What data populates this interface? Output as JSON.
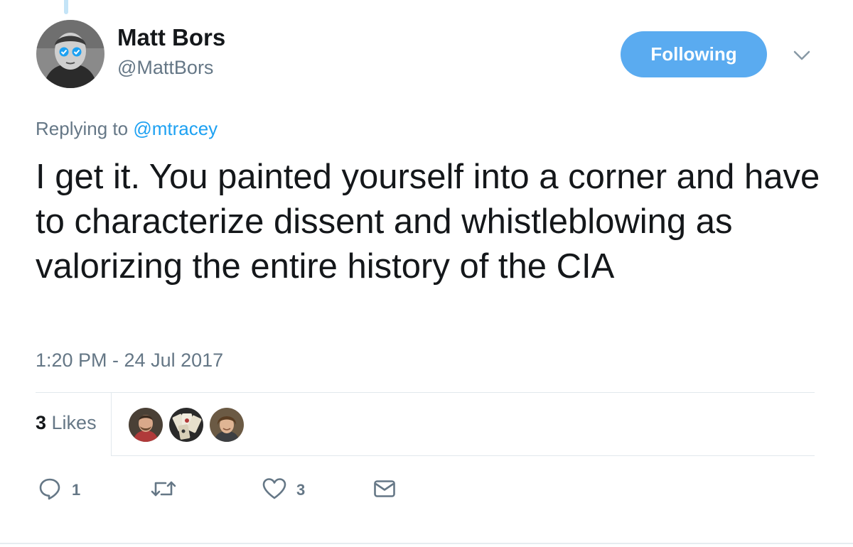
{
  "author": {
    "display_name": "Matt Bors",
    "handle": "@MattBors"
  },
  "follow_button": {
    "label": "Following"
  },
  "reply_context": {
    "prefix": "Replying to ",
    "mention": "@mtracey"
  },
  "tweet": {
    "text": "I get it. You painted yourself into a corner and have to characterize dissent and whistleblowing as valorizing the entire history of the CIA",
    "timestamp": "1:20 PM - 24 Jul 2017"
  },
  "stats": {
    "likes_count": "3",
    "likes_label": " Likes"
  },
  "actions": {
    "reply_count": "1",
    "retweet_count": "",
    "like_count": "3"
  },
  "colors": {
    "accent": "#1da1f2",
    "follow_button_bg": "#5aabf0",
    "secondary_text": "#657786",
    "primary_text": "#14171a",
    "divider": "#e1e8ed"
  },
  "icons": {
    "reply": "reply-icon",
    "retweet": "retweet-icon",
    "like": "heart-icon",
    "dm": "envelope-icon",
    "caret": "chevron-down-icon"
  }
}
